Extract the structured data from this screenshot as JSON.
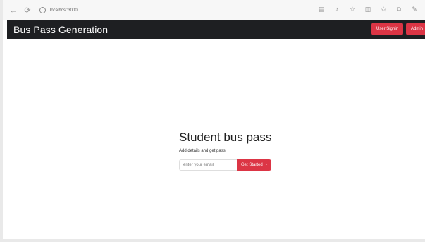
{
  "browser": {
    "url": "localhost:3000",
    "icons": [
      "reader-mode-icon",
      "read-aloud-icon",
      "favorite-icon",
      "split-screen-icon",
      "favorites-icon",
      "collections-icon",
      "extensions-icon"
    ]
  },
  "navbar": {
    "brand": "Bus Pass Generation",
    "buttons": {
      "user_signin": "User Signin",
      "admin": "Admin"
    },
    "colors": {
      "background": "#1e1f22",
      "button": "#dc3545"
    }
  },
  "hero": {
    "title": "Student bus pass",
    "subtitle": "Add details and get pass",
    "email_placeholder": "enter your email",
    "cta_label": "Get Started",
    "cta_icon": "chevron-right-icon"
  }
}
